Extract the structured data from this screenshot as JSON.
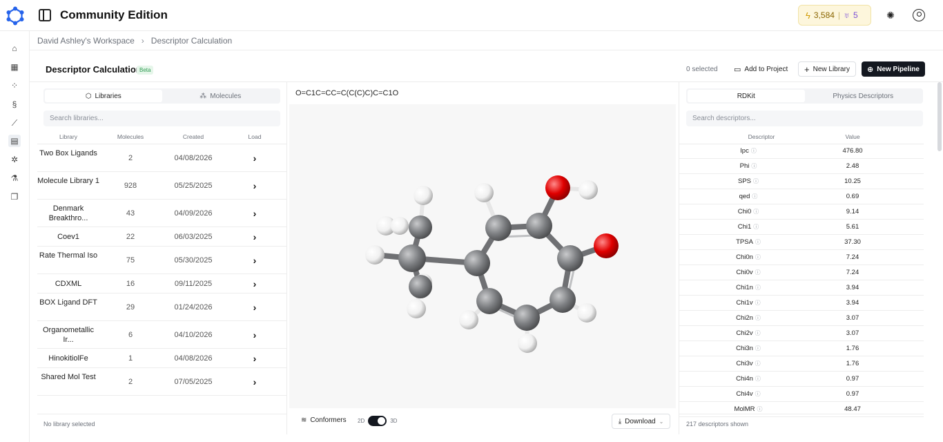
{
  "app": {
    "title": "Community Edition"
  },
  "credits": {
    "tokens": "3,584",
    "gems": "5",
    "bolt_icon": "bolt-icon",
    "gem_icon": "gem-icon"
  },
  "breadcrumb": {
    "workspace": "David Ashley's Workspace",
    "current": "Descriptor Calculation"
  },
  "header": {
    "title": "Descriptor Calculation",
    "badge": "Beta",
    "selected": "0 selected",
    "add_to_project": "Add to Project",
    "new_library": "New Library",
    "new_pipeline": "New Pipeline"
  },
  "rail": [
    "home-icon",
    "table-icon",
    "scatter-icon",
    "dna-icon",
    "line-chart-icon",
    "document-icon",
    "atom-icon",
    "flask-icon",
    "book-icon"
  ],
  "left": {
    "tabs": [
      "Libraries",
      "Molecules"
    ],
    "search_placeholder": "Search libraries...",
    "columns": [
      "Library",
      "Molecules",
      "Created",
      "Load"
    ],
    "rows": [
      {
        "name": "Two Box Ligands",
        "molecules": "2",
        "created": "04/08/2026"
      },
      {
        "name": "Molecule Library 1",
        "molecules": "928",
        "created": "05/25/2025"
      },
      {
        "name": "Denmark Breakthro...",
        "molecules": "43",
        "created": "04/09/2026"
      },
      {
        "name": "Coev1",
        "molecules": "22",
        "created": "06/03/2025"
      },
      {
        "name": "Rate Thermal Iso",
        "molecules": "75",
        "created": "05/30/2025"
      },
      {
        "name": "CDXML",
        "molecules": "16",
        "created": "09/11/2025"
      },
      {
        "name": "BOX Ligand DFT",
        "molecules": "29",
        "created": "01/24/2026"
      },
      {
        "name": "Organometallic Ir...",
        "molecules": "6",
        "created": "04/10/2026"
      },
      {
        "name": "HinokitiolFe",
        "molecules": "1",
        "created": "04/08/2026"
      },
      {
        "name": "Shared Mol Test",
        "molecules": "2",
        "created": "07/05/2025"
      }
    ],
    "footer": "No library selected"
  },
  "middle": {
    "smiles": "O=C1C=CC=C(C(C)C)C=C1O",
    "conformers": "Conformers",
    "mode_2d": "2D",
    "mode_3d": "3D",
    "download": "Download",
    "atom_colors": {
      "carbon": "#7d7f82",
      "oxygen": "#e00000",
      "hydrogen": "#f4f4f4"
    }
  },
  "right": {
    "tabs": [
      "RDKit",
      "Physics Descriptors"
    ],
    "search_placeholder": "Search descriptors...",
    "columns": [
      "Descriptor",
      "Value"
    ],
    "rows": [
      {
        "name": "Ipc",
        "value": "476.80"
      },
      {
        "name": "Phi",
        "value": "2.48"
      },
      {
        "name": "SPS",
        "value": "10.25"
      },
      {
        "name": "qed",
        "value": "0.69"
      },
      {
        "name": "Chi0",
        "value": "9.14"
      },
      {
        "name": "Chi1",
        "value": "5.61"
      },
      {
        "name": "TPSA",
        "value": "37.30"
      },
      {
        "name": "Chi0n",
        "value": "7.24"
      },
      {
        "name": "Chi0v",
        "value": "7.24"
      },
      {
        "name": "Chi1n",
        "value": "3.94"
      },
      {
        "name": "Chi1v",
        "value": "3.94"
      },
      {
        "name": "Chi2n",
        "value": "3.07"
      },
      {
        "name": "Chi2v",
        "value": "3.07"
      },
      {
        "name": "Chi3n",
        "value": "1.76"
      },
      {
        "name": "Chi3v",
        "value": "1.76"
      },
      {
        "name": "Chi4n",
        "value": "0.97"
      },
      {
        "name": "Chi4v",
        "value": "0.97"
      },
      {
        "name": "MolMR",
        "value": "48.47"
      }
    ],
    "footer": "217 descriptors shown"
  }
}
